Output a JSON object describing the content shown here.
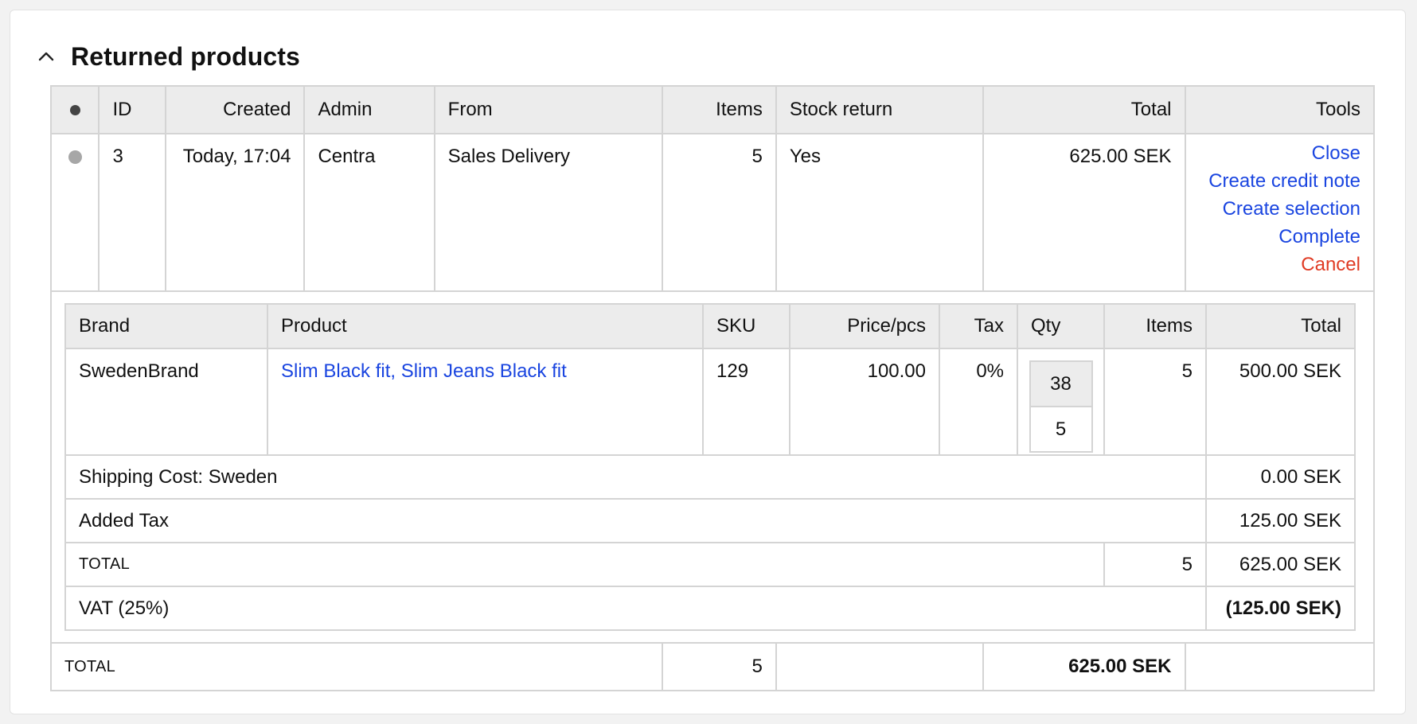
{
  "panel": {
    "title": "Returned products"
  },
  "returns_table": {
    "headers": {
      "id": "ID",
      "created": "Created",
      "admin": "Admin",
      "from": "From",
      "items": "Items",
      "stock_return": "Stock return",
      "total": "Total",
      "tools": "Tools"
    },
    "row": {
      "id": "3",
      "created": "Today, 17:04",
      "admin": "Centra",
      "from": "Sales Delivery",
      "items": "5",
      "stock_return": "Yes",
      "total": "625.00 SEK",
      "tools": {
        "close": "Close",
        "create_credit_note": "Create credit note",
        "create_selection": "Create selection",
        "complete": "Complete",
        "cancel": "Cancel"
      }
    },
    "footer": {
      "label": "TOTAL",
      "items": "5",
      "total": "625.00 SEK"
    }
  },
  "product_table": {
    "headers": {
      "brand": "Brand",
      "product": "Product",
      "sku": "SKU",
      "price": "Price/pcs",
      "tax": "Tax",
      "qty": "Qty",
      "items": "Items",
      "total": "Total"
    },
    "product": {
      "brand": "SwedenBrand",
      "name": "Slim Black fit, Slim Jeans Black fit",
      "sku": "129",
      "price": "100.00",
      "tax": "0%",
      "size": "38",
      "qty": "5",
      "items": "5",
      "total": "500.00 SEK"
    },
    "shipping": {
      "label": "Shipping Cost: Sweden",
      "value": "0.00 SEK"
    },
    "added_tax": {
      "label": "Added Tax",
      "value": "125.00 SEK"
    },
    "subtotal": {
      "label": "TOTAL",
      "items": "5",
      "value": "625.00 SEK"
    },
    "vat": {
      "label": "VAT (25%)",
      "value": "(125.00 SEK)"
    }
  },
  "colors": {
    "link": "#1a45e0",
    "danger": "#e03b24",
    "header_bg": "#ececec",
    "border": "#d4d4d4"
  }
}
